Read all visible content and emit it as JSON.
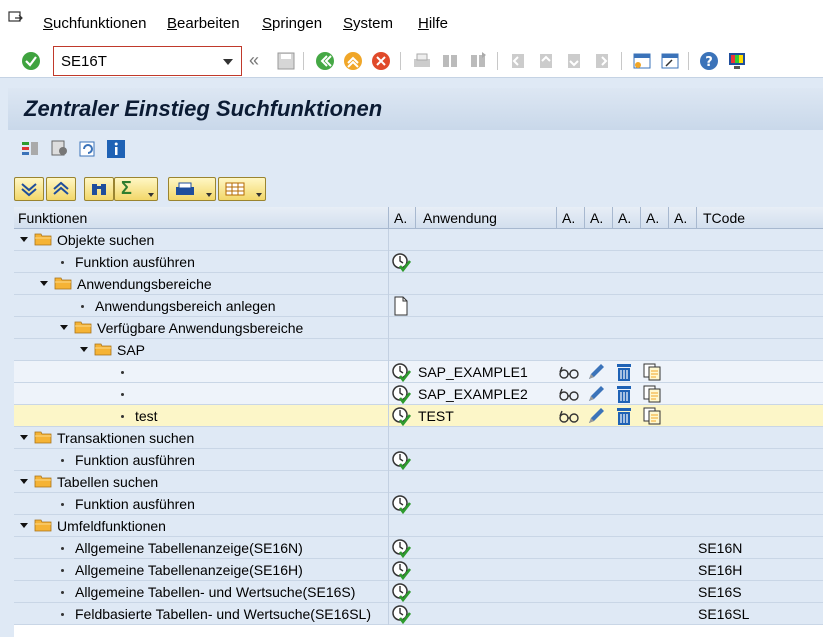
{
  "menu": {
    "items": [
      "Suchfunktionen",
      "Bearbeiten",
      "Springen",
      "System",
      "Hilfe"
    ]
  },
  "toolbar": {
    "command_value": "SE16T"
  },
  "page": {
    "title": "Zentraler Einstieg Suchfunktionen"
  },
  "grid": {
    "columns": [
      "Funktionen",
      "A.",
      "Anwendung",
      "A.",
      "A.",
      "A.",
      "A.",
      "A.",
      "TCode"
    ],
    "rows": [
      {
        "text": "Objekte suchen",
        "level": 0,
        "type": "folder",
        "tcode": "",
        "app": ""
      },
      {
        "text": "Funktion ausführen",
        "level": 1,
        "type": "leaf",
        "tcode": "",
        "app": "",
        "exec": true
      },
      {
        "text": "Anwendungsbereiche",
        "level": 1,
        "type": "folder",
        "tcode": "",
        "app": ""
      },
      {
        "text": "Anwendungsbereich anlegen",
        "level": 2,
        "type": "leaf",
        "tcode": "",
        "app": "",
        "doc": true
      },
      {
        "text": "Verfügbare Anwendungsbereiche",
        "level": 2,
        "type": "folder",
        "tcode": "",
        "app": ""
      },
      {
        "text": "SAP",
        "level": 3,
        "type": "folder",
        "tcode": "",
        "app": ""
      },
      {
        "text": "",
        "level": 4,
        "type": "leaf",
        "tcode": "",
        "app": "SAP_EXAMPLE1",
        "exec": true,
        "actions": true
      },
      {
        "text": "",
        "level": 4,
        "type": "leaf",
        "tcode": "",
        "app": "SAP_EXAMPLE2",
        "exec": true,
        "actions": true
      },
      {
        "text": "test",
        "level": 4,
        "type": "leaf",
        "tcode": "",
        "app": "TEST",
        "exec": true,
        "actions": true,
        "selected": true
      },
      {
        "text": "Transaktionen suchen",
        "level": 0,
        "type": "folder",
        "tcode": "",
        "app": ""
      },
      {
        "text": "Funktion ausführen",
        "level": 1,
        "type": "leaf",
        "tcode": "",
        "app": "",
        "exec": true
      },
      {
        "text": "Tabellen suchen",
        "level": 0,
        "type": "folder",
        "tcode": "",
        "app": ""
      },
      {
        "text": "Funktion ausführen",
        "level": 1,
        "type": "leaf",
        "tcode": "",
        "app": "",
        "exec": true
      },
      {
        "text": "Umfeldfunktionen",
        "level": 0,
        "type": "folder",
        "tcode": "",
        "app": ""
      },
      {
        "text": "Allgemeine Tabellenanzeige(SE16N)",
        "level": 1,
        "type": "leaf",
        "tcode": "SE16N",
        "app": "",
        "exec": true
      },
      {
        "text": "Allgemeine Tabellenanzeige(SE16H)",
        "level": 1,
        "type": "leaf",
        "tcode": "SE16H",
        "app": "",
        "exec": true
      },
      {
        "text": "Allgemeine Tabellen- und Wertsuche(SE16S)",
        "level": 1,
        "type": "leaf",
        "tcode": "SE16S",
        "app": "",
        "exec": true
      },
      {
        "text": "Feldbasierte Tabellen- und Wertsuche(SE16SL)",
        "level": 1,
        "type": "leaf",
        "tcode": "SE16SL",
        "app": "",
        "exec": true
      }
    ]
  },
  "colors": {
    "folder": "#f5b335",
    "selected_row": "#fcf6c8",
    "exec_green": "#2e9b2e"
  }
}
